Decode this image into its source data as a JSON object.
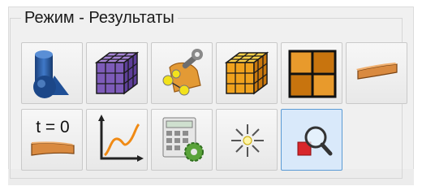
{
  "group": {
    "title": "Режим - Результаты"
  },
  "buttons": [
    {
      "icon": "geometry-shapes-icon",
      "selected": false
    },
    {
      "icon": "mesh-cube-purple-icon",
      "selected": false
    },
    {
      "icon": "physics-settings-wrench-icon",
      "selected": false
    },
    {
      "icon": "mesh-cube-orange-icon",
      "selected": false
    },
    {
      "icon": "mesh-grid-icon",
      "selected": false
    },
    {
      "icon": "deformed-beam-icon",
      "selected": false
    },
    {
      "icon": "initial-state-icon",
      "label": "t = 0",
      "selected": false
    },
    {
      "icon": "plot-graph-icon",
      "selected": false
    },
    {
      "icon": "calculator-settings-icon",
      "selected": false
    },
    {
      "icon": "light-sparkle-icon",
      "selected": false
    },
    {
      "icon": "zoom-inspect-icon",
      "selected": true
    }
  ],
  "colors": {
    "selected_bg": "#d9e9fa",
    "selected_border": "#5b9bd5"
  }
}
